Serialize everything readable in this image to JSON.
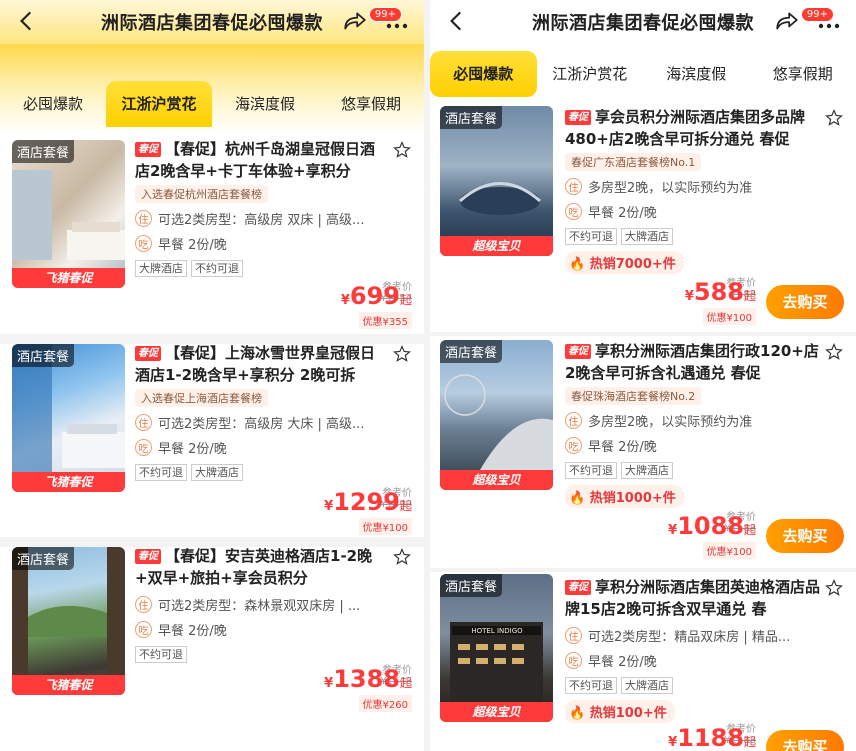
{
  "left": {
    "title": "洲际酒店集团春促必囤爆款",
    "badge": "99+",
    "tabs": [
      "必囤爆款",
      "江浙沪赏花",
      "海滨度假",
      "悠享假期"
    ],
    "active_tab": 1,
    "items": [
      {
        "thumb_tag": "酒店套餐",
        "thumb_foot": "飞猪春促",
        "tag": "春促",
        "name": "【春促】杭州千岛湖皇冠假日酒店2晚含早+卡丁车体验+享积分",
        "rank": "入选春促杭州酒店套餐榜",
        "room": "可选2类房型：高级房 双床 | 高级...",
        "breakfast": "早餐 2份/晚",
        "chips": [
          "大牌酒店",
          "不约可退"
        ],
        "ref_label": "参考价",
        "ref_price": "¥1054",
        "price": "699",
        "discount": "优惠¥355"
      },
      {
        "thumb_tag": "酒店套餐",
        "thumb_foot": "飞猪春促",
        "tag": "春促",
        "name": "【春促】上海冰雪世界皇冠假日酒店1-2晚含早+享积分 2晚可拆",
        "rank": "入选春促上海酒店套餐榜",
        "room": "可选2类房型：高级房 大床 | 高级...",
        "breakfast": "早餐 2份/晚",
        "chips": [
          "不约可退",
          "大牌酒店"
        ],
        "ref_label": "参考价",
        "ref_price": "¥1399",
        "price": "1299",
        "discount": "优惠¥100"
      },
      {
        "thumb_tag": "酒店套餐",
        "thumb_foot": "飞猪春促",
        "tag": "春促",
        "name": "【春促】安吉英迪格酒店1-2晚+双早+旅拍+享会员积分",
        "room": "可选2类房型：森林景观双床房 | ...",
        "breakfast": "早餐 2份/晚",
        "chips": [
          "不约可退"
        ],
        "ref_label": "参考价",
        "ref_price": "¥1648",
        "price": "1388",
        "discount": "优惠¥260"
      }
    ]
  },
  "right": {
    "title": "洲际酒店集团春促必囤爆款",
    "badge": "99+",
    "tabs": [
      "必囤爆款",
      "江浙沪赏花",
      "海滨度假",
      "悠享假期"
    ],
    "active_tab": 0,
    "buy_label": "去购买",
    "items": [
      {
        "thumb_tag": "酒店套餐",
        "thumb_foot": "超级宝贝",
        "tag": "春促",
        "name": "享会员积分洲际酒店集团多品牌480+店2晚含早可拆分通兑 春促",
        "rank": "春促广东酒店套餐榜No.1",
        "room": "多房型2晚，以实际预约为准",
        "breakfast": "早餐 2份/晚",
        "chips": [
          "不约可退",
          "大牌酒店"
        ],
        "hot": "热销7000+件",
        "ref_label": "参考价",
        "ref_price": "¥688",
        "price": "588",
        "discount": "优惠¥100"
      },
      {
        "thumb_tag": "酒店套餐",
        "thumb_foot": "超级宝贝",
        "tag": "春促",
        "name": "享积分洲际酒店集团行政120+店2晚含早可拆含礼遇通兑 春促",
        "rank": "春促珠海酒店套餐榜No.2",
        "room": "多房型2晚，以实际预约为准",
        "breakfast": "早餐 2份/晚",
        "chips": [
          "不约可退",
          "大牌酒店"
        ],
        "hot": "热销1000+件",
        "ref_label": "参考价",
        "ref_price": "¥1188",
        "price": "1088",
        "discount": "优惠¥100"
      },
      {
        "thumb_tag": "酒店套餐",
        "thumb_foot": "超级宝贝",
        "thumb_sign": "HOTEL INDIGO",
        "tag": "春促",
        "name": "享积分洲际酒店集团英迪格酒店品牌15店2晚可拆含双早通兑 春",
        "room": "可选2类房型：精品双床房 | 精品...",
        "breakfast": "早餐 2份/晚",
        "chips": [
          "不约可退",
          "大牌酒店"
        ],
        "hot": "热销100+件",
        "ref_label": "参考价",
        "ref_price": "¥1288",
        "price": "1188",
        "discount": ""
      }
    ]
  },
  "common": {
    "yen": "¥",
    "qi": "起",
    "room_icon": "住",
    "food_icon": "吃",
    "flame": "🔥"
  }
}
